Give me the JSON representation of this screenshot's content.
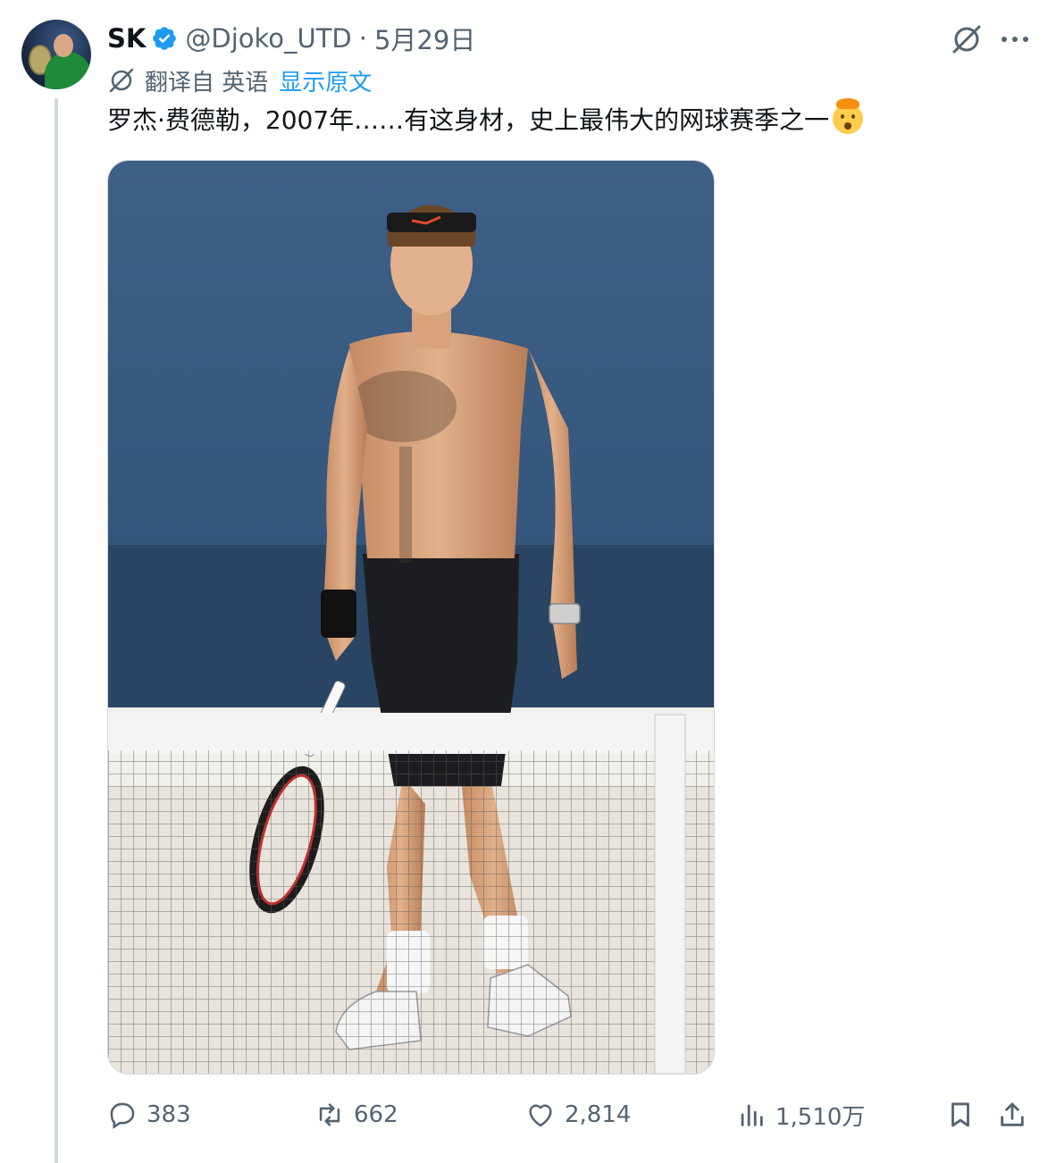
{
  "author": {
    "display_name": "SK",
    "handle": "@Djoko_UTD",
    "separator": "·",
    "date": "5月29日",
    "verified_color": "#1d9bf0"
  },
  "translation": {
    "label": "翻译自 英语",
    "show_original": "显示原文"
  },
  "tweet": {
    "text": "罗杰·费德勒，2007年……有这身材，史上最伟大的网球赛季之一",
    "emoji": "exploding-head-emoji"
  },
  "actions": {
    "replies": "383",
    "retweets": "662",
    "likes": "2,814",
    "views": "1,510万"
  },
  "icons": {
    "grok": "grok-icon",
    "more": "more-icon",
    "reply": "reply-icon",
    "retweet": "retweet-icon",
    "like": "heart-icon",
    "views": "analytics-icon",
    "bookmark": "bookmark-icon",
    "share": "share-icon"
  },
  "colors": {
    "accent": "#1d9bf0",
    "muted": "#536471",
    "text": "#0f1419"
  }
}
